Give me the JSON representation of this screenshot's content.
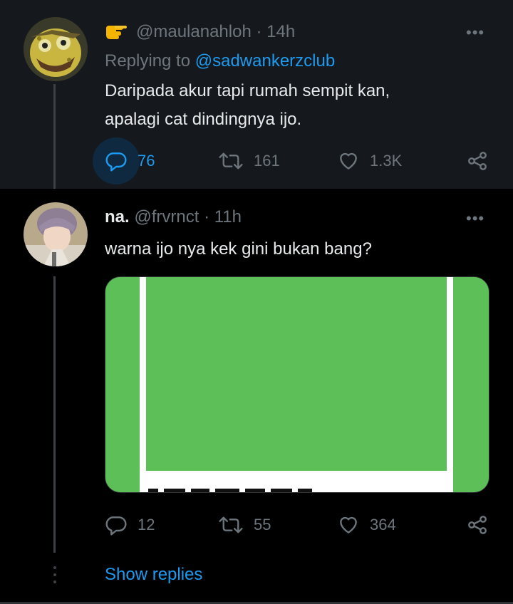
{
  "tweet1": {
    "handle": "@maulanahloh",
    "time": "· 14h",
    "more": "•••",
    "reply_prefix": "Replying to ",
    "reply_handle": "@sadwankerzclub",
    "text_line1": "Daripada akur tapi rumah sempit kan,",
    "text_line2": "apalagi cat dindingnya ijo.",
    "replies": "76",
    "retweets": "161",
    "likes": "1.3K"
  },
  "tweet2": {
    "display_name": "na.",
    "handle": "@frvrnct",
    "time": "· 11h",
    "more": "•••",
    "text": "warna ijo nya kek gini bukan bang?",
    "media_colors": {
      "green": "#5cbf58",
      "frame": "#ffffff"
    },
    "replies": "12",
    "retweets": "55",
    "likes": "364"
  },
  "show_replies": "Show replies",
  "colors": {
    "accent": "#1d9bf0",
    "muted": "#6e767d",
    "bg": "#000000",
    "card": "#15181c"
  },
  "icons": [
    "pointing-hand-icon",
    "reply-icon",
    "retweet-icon",
    "like-icon",
    "share-icon",
    "more-icon"
  ]
}
